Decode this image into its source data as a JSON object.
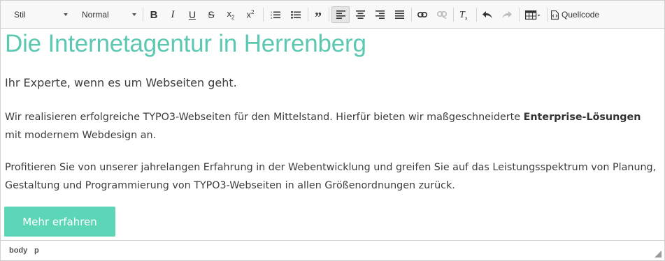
{
  "toolbar": {
    "style_select": "Stil",
    "format_select": "Normal",
    "bold": "B",
    "italic": "I",
    "underline": "U",
    "strikethrough": "S",
    "subscript": "x",
    "superscript": "x",
    "source_label": "Quellcode"
  },
  "content": {
    "heading": "Die Internetagentur in Herrenberg",
    "lead": "Ihr Experte, wenn es um Webseiten geht.",
    "para1_text": "Wir realisieren erfolgreiche TYPO3-Webseiten für den Mittelstand. Hierfür bieten wir maßgeschneiderte ",
    "para1_bold": "Enterprise-Lösungen",
    "para1_line2": "mit modernem Webdesign an.",
    "para2": "Profitieren Sie von unserer jahrelangen Erfahrung in der Webentwicklung und greifen Sie auf das Leistungsspektrum von Planung, Gestaltung und Programmierung von TYPO3-Webseiten in allen Größenordnungen zurück.",
    "cta": "Mehr erfahren"
  },
  "statusbar": {
    "path": [
      "body",
      "p"
    ]
  },
  "colors": {
    "accent": "#5cc8b1",
    "button": "#5dd6b8",
    "toolbar_bg": "#f8f8f8",
    "border": "#d1d1d1"
  },
  "icons": [
    "ordered-list-icon",
    "bullet-list-icon",
    "blockquote-icon",
    "align-left-icon",
    "align-center-icon",
    "align-right-icon",
    "justify-icon",
    "link-icon",
    "unlink-icon",
    "remove-format-icon",
    "undo-icon",
    "redo-icon",
    "table-icon",
    "source-code-icon",
    "resize-handle-icon"
  ]
}
